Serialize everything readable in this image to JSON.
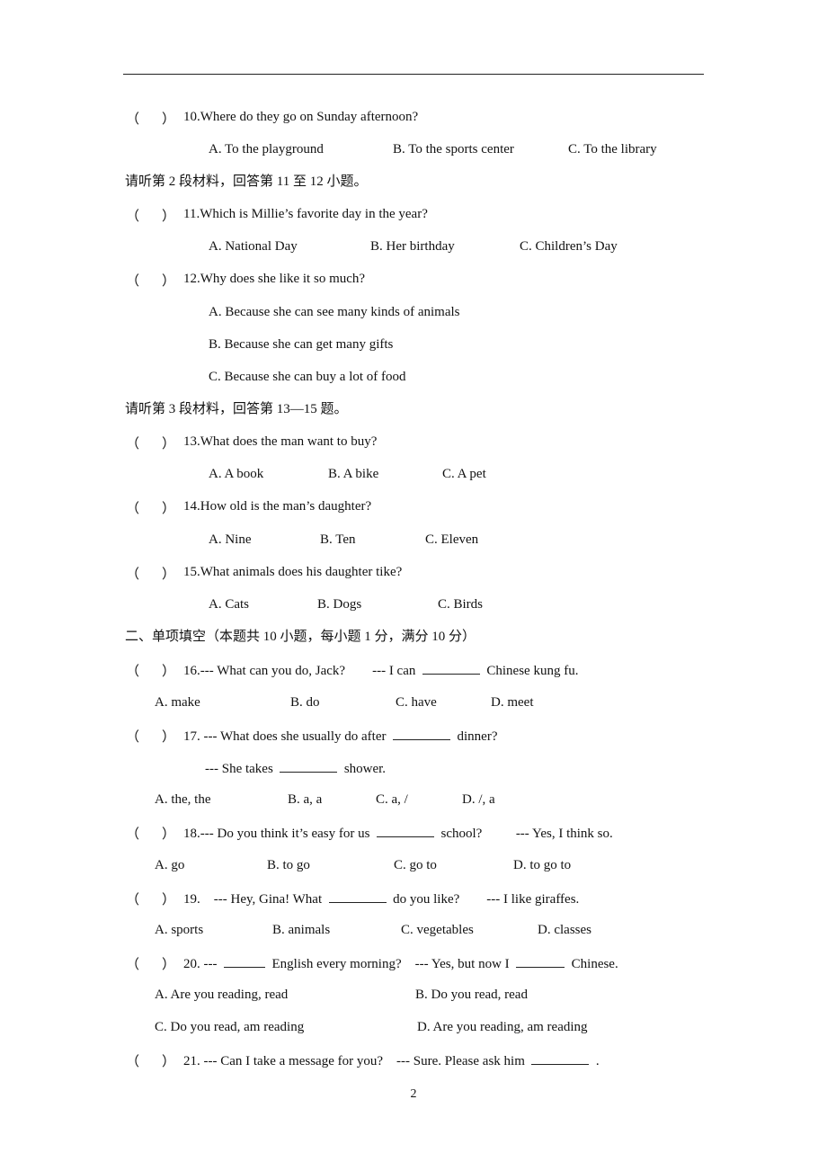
{
  "page_number": "2",
  "questions": {
    "q10": {
      "stem": "10.Where do they go on Sunday afternoon?",
      "options": [
        "A. To the playground",
        "B. To the sports center",
        "C. To the library"
      ]
    },
    "section2_intro": "请听第 2 段材料，回答第 11 至 12 小题。",
    "q11": {
      "stem": "11.Which is Millie’s favorite day in the year?",
      "options": [
        "A. National Day",
        "B. Her birthday",
        "C. Children’s Day"
      ]
    },
    "q12": {
      "stem": "12.Why does she like it so much?",
      "options": [
        "A. Because she can see many kinds of animals",
        "B. Because she can get many gifts",
        "C. Because she can buy a lot of food"
      ]
    },
    "section3_intro": "请听第 3 段材料，回答第 13—15 题。",
    "q13": {
      "stem": "13.What does the man want to buy?",
      "options": [
        "A. A book",
        "B. A bike",
        "C. A pet"
      ]
    },
    "q14": {
      "stem": "14.How old is the man’s daughter?",
      "options": [
        "A. Nine",
        "B. Ten",
        "C. Eleven"
      ]
    },
    "q15": {
      "stem": "15.What animals does his daughter tike?",
      "options": [
        "A. Cats",
        "B. Dogs",
        "C. Birds"
      ]
    },
    "part2_heading": "二、单项填空（本题共 10 小题，每小题 1 分，满分 10 分）",
    "q16": {
      "stem_a": "16.--- What can you do, Jack?",
      "stem_b": "--- I can",
      "stem_c": "Chinese kung fu.",
      "options": [
        "A. make",
        "B. do",
        "C. have",
        "D. meet"
      ]
    },
    "q17": {
      "stem_a": "17. --- What does she usually do after",
      "stem_b": "dinner?",
      "line2_a": "--- She takes",
      "line2_b": "shower.",
      "options": [
        "A. the, the",
        "B. a, a",
        "C. a, /",
        "D. /, a"
      ]
    },
    "q18": {
      "stem_a": "18.--- Do you think it’s easy for us",
      "stem_b": "school?",
      "stem_c": "--- Yes, I think so.",
      "options": [
        "A. go",
        "B. to go",
        "C. go to",
        "D. to go to"
      ]
    },
    "q19": {
      "stem_a": "19.",
      "stem_b": "--- Hey, Gina! What",
      "stem_c": "do you like?",
      "stem_d": "--- I like giraffes.",
      "options": [
        "A. sports",
        "B. animals",
        "C. vegetables",
        "D. classes"
      ]
    },
    "q20": {
      "stem_a": "20. ---",
      "stem_b": "English every morning?",
      "stem_c": "--- Yes, but now I",
      "stem_d": "Chinese.",
      "options": [
        "A. Are you reading, read",
        "B. Do you read, read",
        "C. Do you read, am reading",
        "D. Are you reading, am reading"
      ]
    },
    "q21": {
      "stem_a": "21. --- Can I take a message for you?",
      "stem_b": "--- Sure. Please ask him",
      "stem_c": "."
    }
  },
  "answer_paren_open": "（",
  "answer_paren_close": "）"
}
